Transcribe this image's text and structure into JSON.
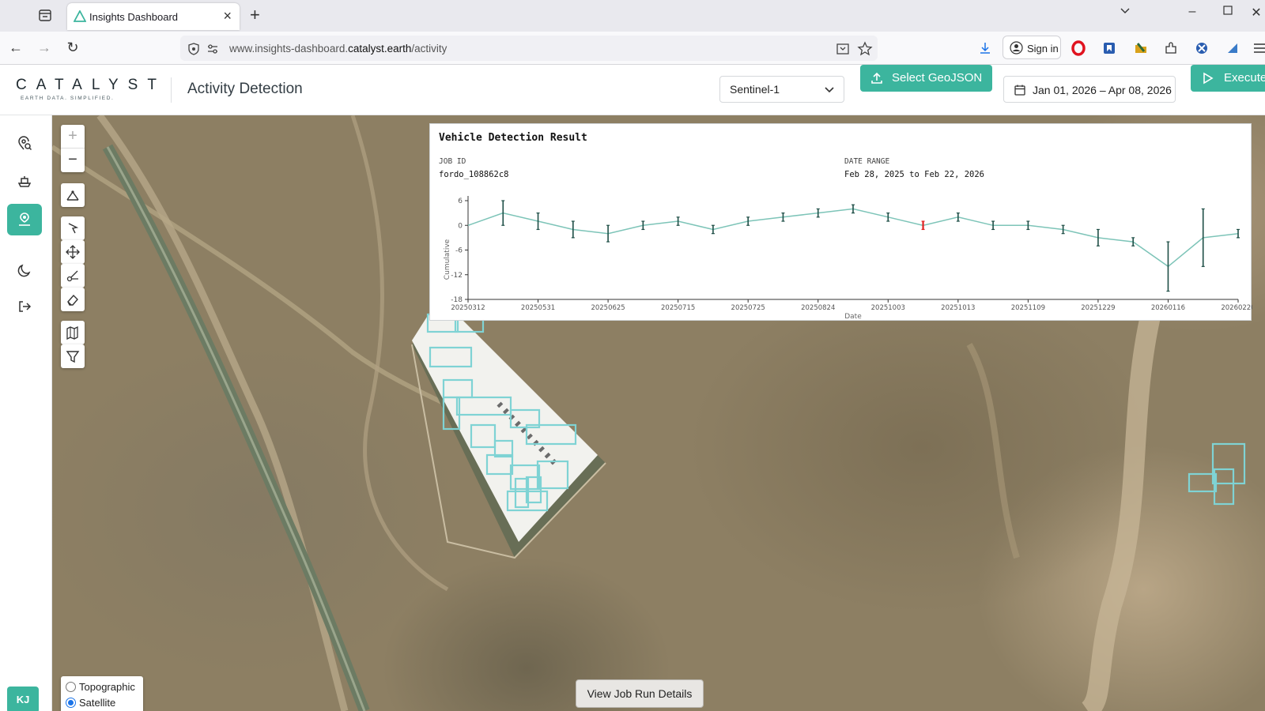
{
  "browser": {
    "tab_title": "Insights Dashboard",
    "url_prefix": "www.insights-dashboard.",
    "url_domain": "catalyst.earth",
    "url_path": "/activity",
    "sign_in": "Sign in"
  },
  "header": {
    "brand_name": "CATALYST",
    "brand_tagline": "EARTH DATA. SIMPLIFIED.",
    "page_title": "Activity Detection",
    "sensor_select": "Sentinel-1",
    "geojson_button": "Select GeoJSON",
    "date_range": "Jan 01, 2026 – Apr 08, 2026",
    "execute_button": "Execute",
    "accent_color": "#3cb59e"
  },
  "sidebar": {
    "items": [
      {
        "icon": "location-search-icon"
      },
      {
        "icon": "ship-icon"
      },
      {
        "icon": "person-location-icon",
        "active": true
      },
      {
        "icon": "moon-icon"
      },
      {
        "icon": "logout-icon"
      }
    ],
    "avatar": "KJ"
  },
  "map": {
    "zoom_in": "+",
    "zoom_out": "−",
    "basemaps": [
      {
        "label": "Topographic",
        "selected": false
      },
      {
        "label": "Satellite",
        "selected": true
      }
    ],
    "job_button": "View Job Run Details"
  },
  "result": {
    "title": "Vehicle Detection Result",
    "job_id_label": "JOB ID",
    "job_id": "fordo_108862c8",
    "date_range_label": "DATE RANGE",
    "date_range": "Feb 28, 2025 to Feb 22, 2026"
  },
  "chart_data": {
    "type": "line",
    "xlabel": "Date",
    "ylabel": "Cumulative",
    "ylim": [
      -18,
      6
    ],
    "yticks": [
      6,
      0,
      -6,
      -12,
      -18
    ],
    "xticks": [
      "20250312",
      "20250531",
      "20250625",
      "20250715",
      "20250725",
      "20250824",
      "20251003",
      "20251013",
      "20251109",
      "20251229",
      "20260116",
      "20260220"
    ],
    "line_color": "#7dc4b8",
    "error_bar_color": "#1f4f47",
    "highlight_color": "#e02020",
    "series": [
      {
        "values": [
          0,
          3,
          1,
          -1,
          -2,
          0,
          1,
          -1,
          1,
          2,
          3,
          4,
          2,
          0,
          2,
          0,
          0,
          -1,
          -3,
          -4,
          -10,
          -3,
          -2
        ],
        "errors": [
          0,
          3,
          2,
          2,
          2,
          1,
          1,
          1,
          1,
          1,
          1,
          1,
          1,
          1,
          1,
          1,
          1,
          1,
          2,
          1,
          6,
          7,
          1
        ],
        "highlight_index": 13
      }
    ]
  }
}
